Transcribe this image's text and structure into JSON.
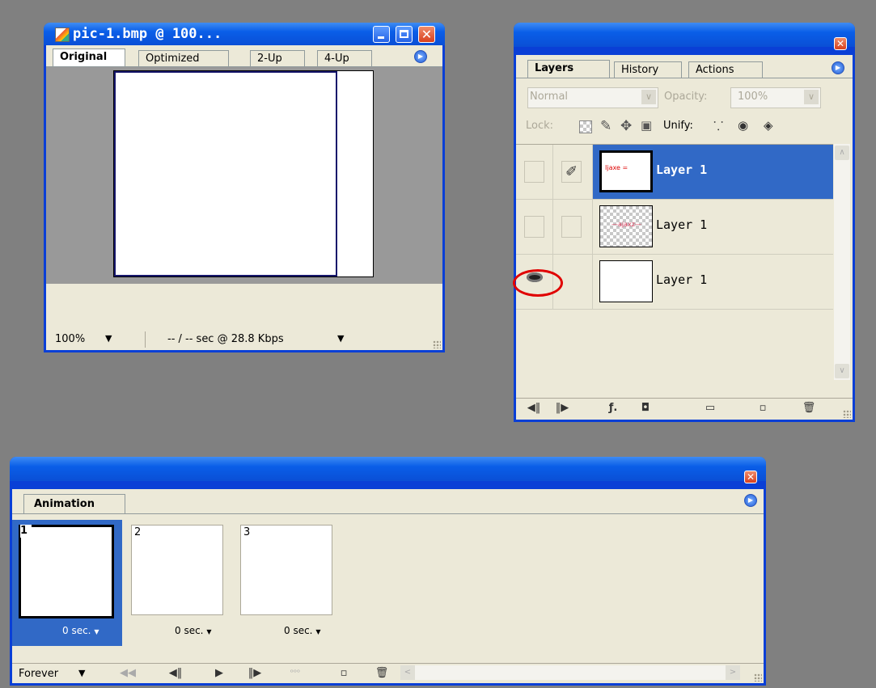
{
  "doc_window": {
    "title": "pic-1.bmp @ 100...",
    "tabs": [
      "Original",
      "Optimized",
      "2-Up",
      "4-Up"
    ],
    "zoom": "100%",
    "status": "-- / -- sec @ 28.8 Kbps"
  },
  "layers_panel": {
    "tabs": [
      "Layers",
      "History",
      "Actions"
    ],
    "blend_mode": "Normal",
    "opacity_label": "Opacity:",
    "opacity_value": "100%",
    "lock_label": "Lock:",
    "unify_label": "Unify:",
    "layers": [
      {
        "name": "Layer 1",
        "selected": true,
        "visible": false,
        "thumb_text": "Ijaxe ="
      },
      {
        "name": "Layer 1",
        "selected": false,
        "visible": false,
        "thumb_text": "—ajaxz—"
      },
      {
        "name": "Layer 1",
        "selected": false,
        "visible": true,
        "thumb_text": ""
      }
    ],
    "highlight_color": "#3169c6",
    "annotation_color": "#e00000"
  },
  "animation_panel": {
    "tab": "Animation",
    "frames": [
      {
        "number": "1",
        "delay": "0 sec.",
        "selected": true
      },
      {
        "number": "2",
        "delay": "0 sec.",
        "selected": false
      },
      {
        "number": "3",
        "delay": "0 sec.",
        "selected": false
      }
    ],
    "loop": "Forever"
  }
}
